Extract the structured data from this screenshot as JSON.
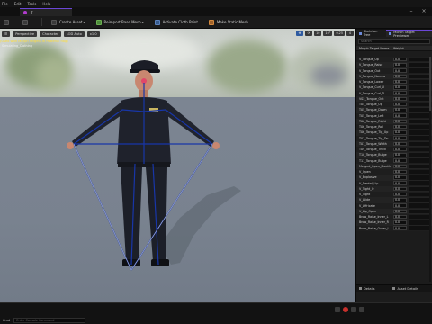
{
  "menu": [
    "File",
    "Edit",
    "Tools",
    "Help"
  ],
  "document_tab": {
    "label": "T"
  },
  "toolbar": {
    "buttons": [
      "Create Asset",
      "Reimport Base Mesh",
      "Activate Cloth Paint",
      "Make Static Mesh"
    ]
  },
  "viewport": {
    "chips": [
      "Perspective",
      "Character",
      "LOD Auto",
      "x1.0"
    ],
    "right_chips": [
      "10",
      "10°",
      "0.25",
      "4"
    ],
    "warning": "(Used with Morph Targets in material flag)",
    "info": "Simulating_Clothing"
  },
  "panel": {
    "tabs": [
      "Skeleton Tree",
      "Morph Target Previewer"
    ],
    "search_placeholder": "Search",
    "col_name": "Morph Target Name",
    "col_weight": "Weight",
    "morphs": [
      "V_Tongue_Up",
      "V_Tongue_Raise",
      "V_Tongue_Out",
      "V_Tongue_Narrow",
      "V_Tongue_Lower",
      "V_Tongue_Curl_U",
      "V_Tongue_Curl_D",
      "V02_Tongue_Out",
      "T05_Tongue_Up",
      "T05_Tongue_Down",
      "T05_Tongue_Left",
      "T06_Tongue_Right",
      "T06_Tongue_Roll",
      "T06_Tongue_Tip_Up",
      "T07_Tongue_Tip_Dn",
      "T07_Tongue_Width",
      "T09_Tongue_Thick",
      "T10_Tongue_Bulge",
      "T11_Tongue_Bulge",
      "Merged_Open_Mouth",
      "V_Open",
      "V_Explosive",
      "V_Dental_Lip",
      "V_Tight_O",
      "V_Tight",
      "V_Wide",
      "V_Affricate",
      "V_Lip_Open",
      "Brow_Raise_Inner_L",
      "Brow_Raise_Inner_R",
      "Brow_Raise_Outer_L"
    ],
    "weight_value": "0.0",
    "bottom_tabs": [
      "Details",
      "Asset Details"
    ]
  },
  "status": {
    "cmd_label": "Cmd",
    "cmd_placeholder": "Enter Console Command"
  }
}
